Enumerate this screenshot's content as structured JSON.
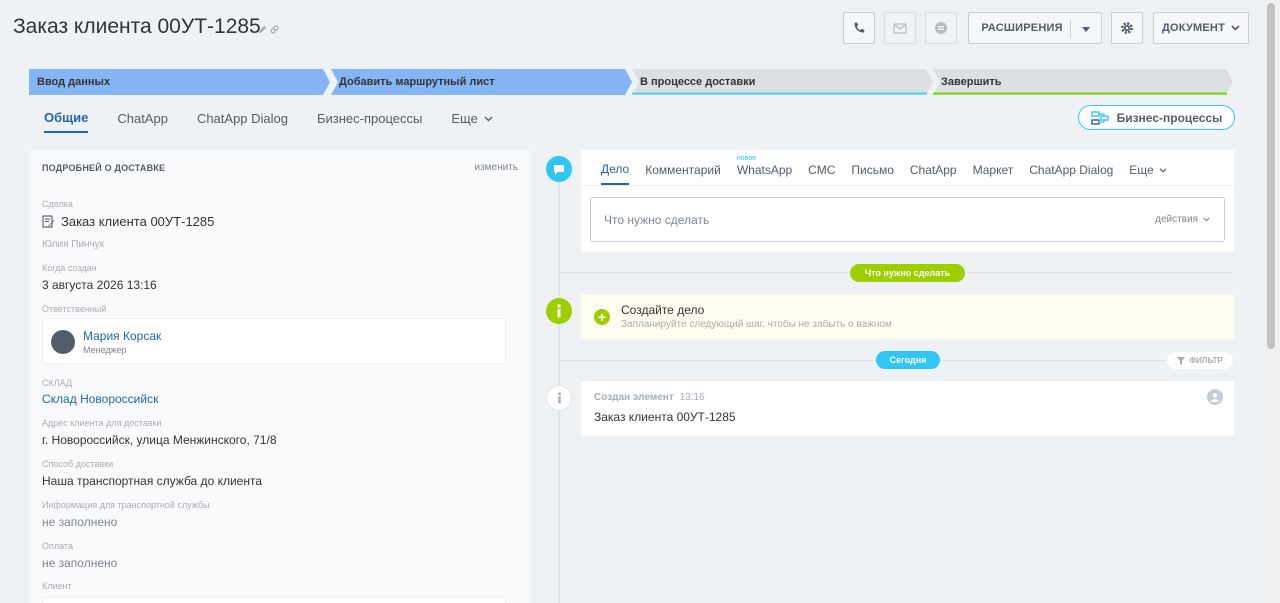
{
  "header": {
    "title": "Заказ клиента 00УТ-1285",
    "extensions_label": "РАСШИРЕНИЯ",
    "document_label": "ДОКУМЕНТ"
  },
  "stages": [
    {
      "label": "Ввод данных",
      "color": "#85b5f5"
    },
    {
      "label": "Добавить маршрутный лист",
      "color": "#85b5f5"
    },
    {
      "label": "В процессе доставки",
      "color": "#dde0e3",
      "accent": "#47d1f5"
    },
    {
      "label": "Завершить",
      "color": "#dde0e3",
      "accent": "#7bd500"
    }
  ],
  "tabs": [
    "Общие",
    "ChatApp",
    "ChatApp Dialog",
    "Бизнес-процессы",
    "Еще"
  ],
  "bp_button_label": "Бизнес-процессы",
  "details": {
    "heading": "ПОДРОБНЕЙ О ДОСТАВКЕ",
    "edit_label": "изменить",
    "deal_label": "Сделка",
    "deal_value": "Заказ клиента 00УТ-1285",
    "deal_owner": "Юлия Пинчук",
    "created_label": "Когда создан",
    "created_value": "3 августа 2026 13:16",
    "responsible_label": "Ответственный",
    "responsible_name": "Мария Корсак",
    "responsible_role": "Менеджер",
    "warehouse_label": "СКЛАД",
    "warehouse_value": "Склад Новороссийск",
    "address_label": "Адрес клиента для доставки",
    "address_value": "г. Новороссийск, улица Менжинского, 71/8",
    "delivery_label": "Способ доставки",
    "delivery_value": "Наша транспортная служба до клиента",
    "transport_info_label": "Информация для транспортной службы",
    "transport_info_value": "не заполнено",
    "payment_label": "Оплата",
    "payment_value": "не заполнено",
    "client_label": "Клиент"
  },
  "activity": {
    "tabs": [
      "Дело",
      "Комментарий",
      "WhatsApp",
      "СМС",
      "Письмо",
      "ChatApp",
      "Маркет",
      "ChatApp Dialog",
      "Еще"
    ],
    "new_badge": "новое",
    "input_placeholder": "Что нужно сделать",
    "actions_label": "действия"
  },
  "timeline": {
    "todo_pill": "Что нужно сделать",
    "todo_title": "Создайте дело",
    "todo_subtitle": "Запланируйте следующий шаг, чтобы не забыть о важном",
    "today_pill": "Сегодня",
    "filter_label": "ФИЛЬТР",
    "history_title": "Создан элемент",
    "history_time": "13:16",
    "history_value": "Заказ клиента 00УТ-1285"
  },
  "icons": {
    "phone": "phone-icon",
    "mail": "mail-icon",
    "chat": "chat-icon",
    "gear": "gear-icon"
  },
  "colors": {
    "accent_blue": "#2067b0",
    "cyan": "#2fc6f6",
    "green": "#9dcf00"
  }
}
